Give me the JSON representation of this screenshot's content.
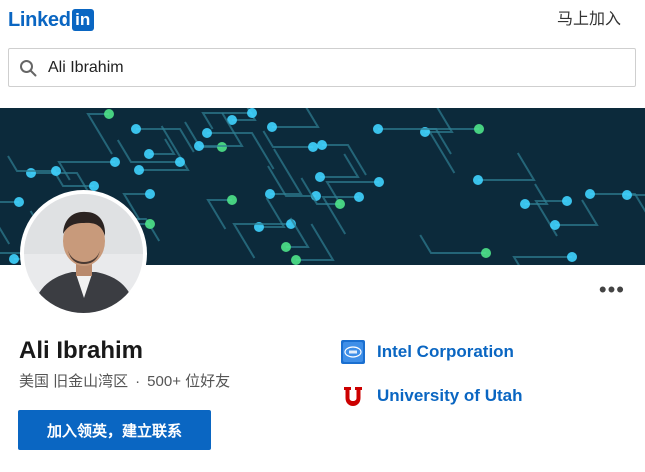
{
  "header": {
    "logo_text": "Linked",
    "logo_in": "in",
    "join_label": "马上加入"
  },
  "search": {
    "value": "Ali Ibrahim"
  },
  "banner": {
    "accent_color": "#0c2a3b",
    "node_color": "#3fd3ff",
    "node_color_alt": "#4ee38a"
  },
  "profile": {
    "name": "Ali Ibrahim",
    "location": "美国 旧金山湾区",
    "separator": "·",
    "connections": "500+ 位好友",
    "more_label": "•••",
    "cta_label": "加入领英，建立联系"
  },
  "organizations": [
    {
      "name": "Intel Corporation",
      "icon": "intel-logo-icon"
    },
    {
      "name": "University of Utah",
      "icon": "utah-u-logo-icon"
    }
  ],
  "colors": {
    "brand": "#0a66c2"
  }
}
